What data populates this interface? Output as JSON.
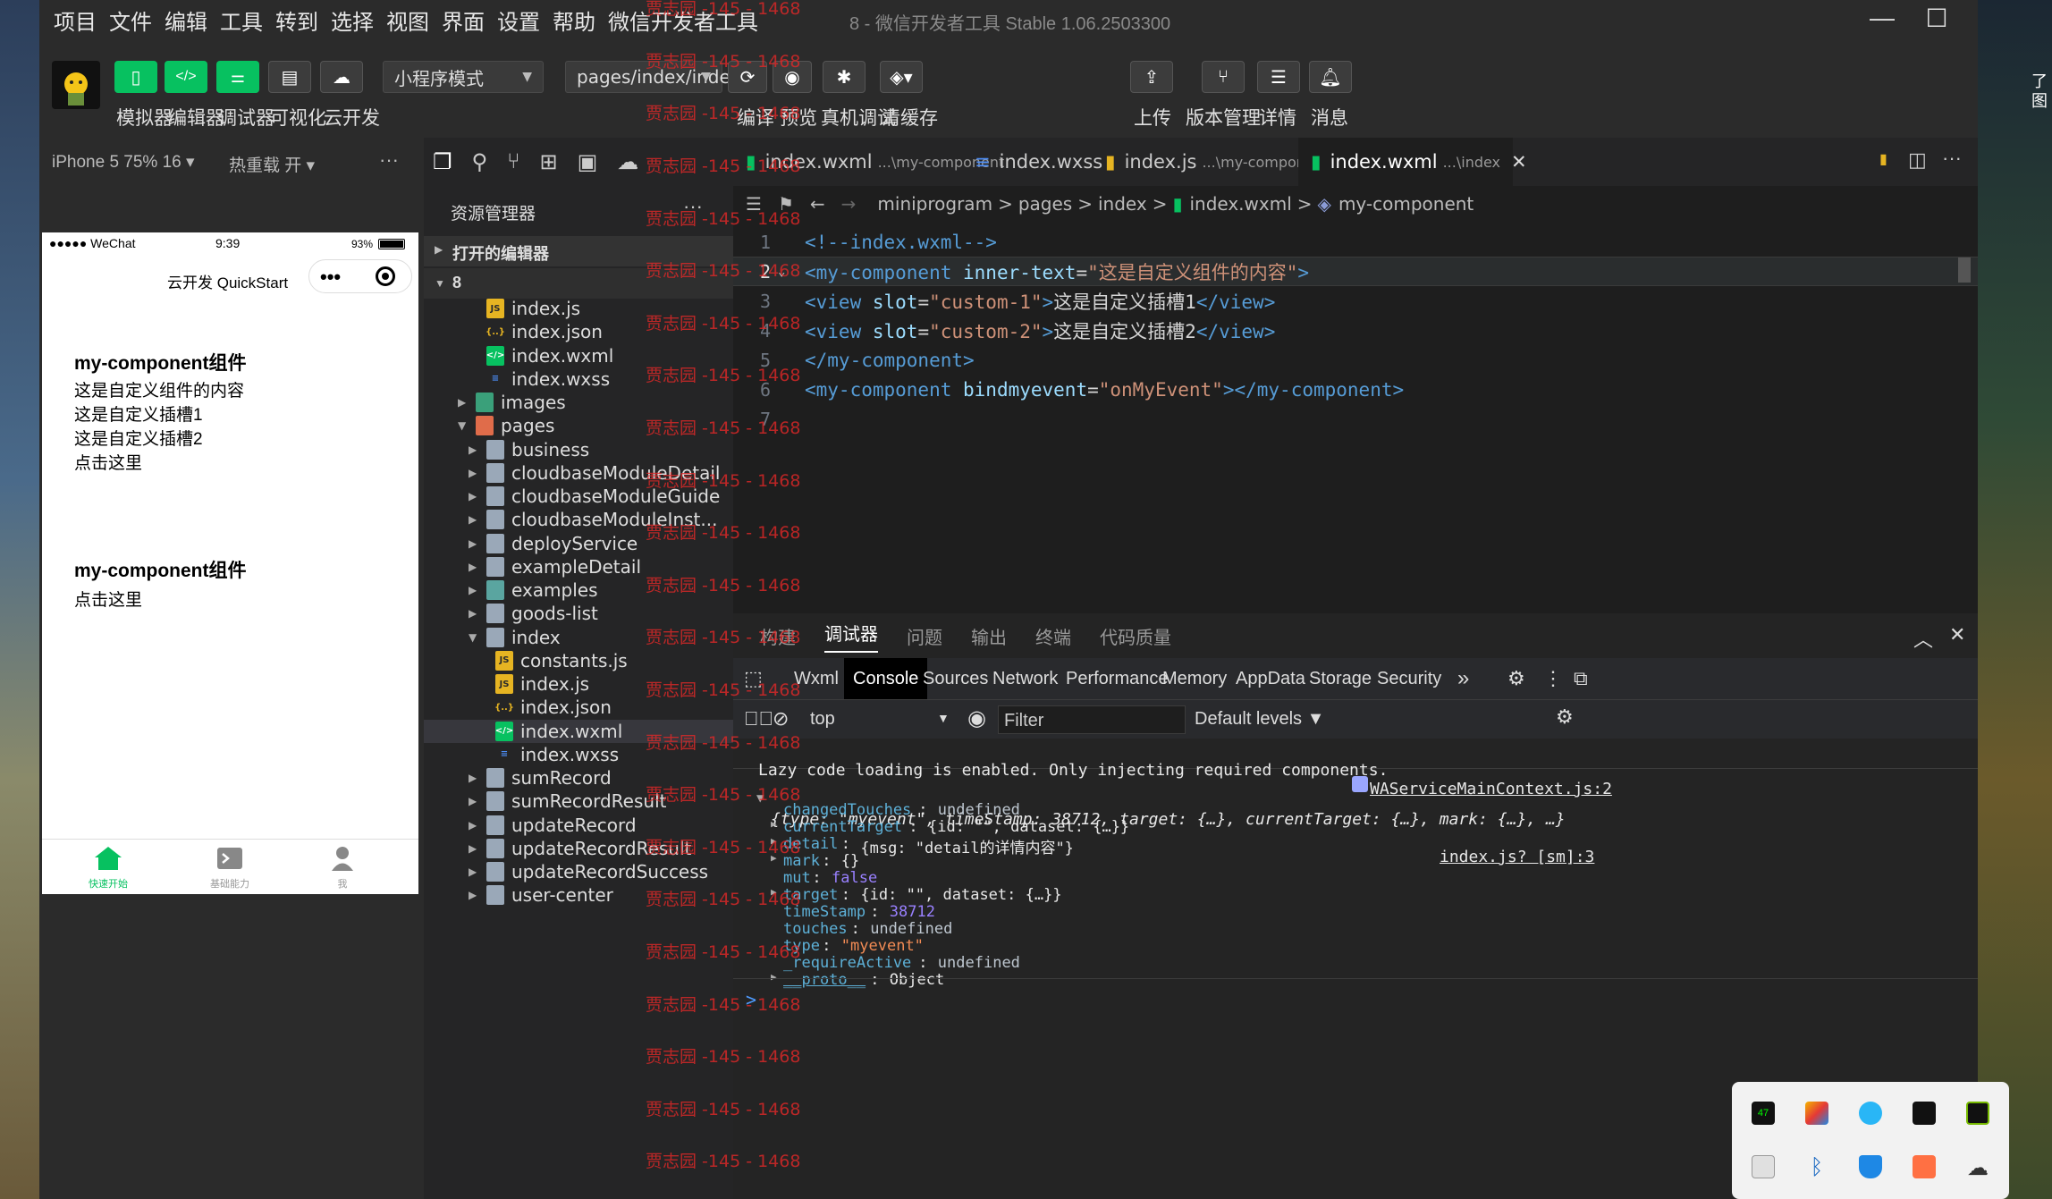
{
  "menubar": [
    "项目",
    "文件",
    "编辑",
    "工具",
    "转到",
    "选择",
    "视图",
    "界面",
    "设置",
    "帮助",
    "微信开发者工具"
  ],
  "window_title": "8 - 微信开发者工具 Stable 1.06.2503300",
  "desktop_side_text": "了\n图",
  "toolbar": {
    "simulator": "模拟器",
    "editor": "编辑器",
    "debugger": "调试器",
    "visual": "可视化",
    "cloud": "云开发",
    "mode_select": "小程序模式",
    "page_select": "pages/index/index",
    "compile": "编译",
    "preview": "预览",
    "real_debug": "真机调试",
    "clear_cache": "清缓存",
    "upload": "上传",
    "version": "版本管理",
    "details": "详情",
    "messages": "消息"
  },
  "sim": {
    "device": "iPhone 5 75% 16",
    "hot_reload": "热重载 开",
    "more": "···",
    "status_carrier": "●●●●● WeChat",
    "status_time": "9:39",
    "status_battery": "93%",
    "nav_title": "云开发 QuickStart",
    "capsule_dots": "•••",
    "block1_title": "my-component组件",
    "block1_lines": [
      "这是自定义组件的内容",
      "这是自定义插槽1",
      "这是自定义插槽2",
      "点击这里"
    ],
    "block2_title": "my-component组件",
    "block2_lines": [
      "点击这里"
    ],
    "tabbar": [
      "快速开始",
      "基础能力",
      "我"
    ],
    "colors": {
      "active": "#07c160",
      "inactive": "#999999"
    }
  },
  "explorer": {
    "title": "资源管理器",
    "more": "···",
    "open_editors": "打开的编辑器",
    "project": "8",
    "rows": [
      {
        "name": "index.js",
        "type": "js",
        "indent": 1
      },
      {
        "name": "index.json",
        "type": "json",
        "indent": 1
      },
      {
        "name": "index.wxml",
        "type": "wxml",
        "indent": 1
      },
      {
        "name": "index.wxss",
        "type": "wxss",
        "indent": 1
      },
      {
        "name": "images",
        "type": "folder-img",
        "indent": 0,
        "arrow": "right"
      },
      {
        "name": "pages",
        "type": "folder-pages",
        "indent": 0,
        "arrow": "down"
      },
      {
        "name": "business",
        "type": "folder",
        "indent": 1,
        "arrow": "right"
      },
      {
        "name": "cloudbaseModuleDetail",
        "type": "folder",
        "indent": 1,
        "arrow": "right"
      },
      {
        "name": "cloudbaseModuleGuide",
        "type": "folder",
        "indent": 1,
        "arrow": "right"
      },
      {
        "name": "cloudbaseModuleInst...",
        "type": "folder",
        "indent": 1,
        "arrow": "right"
      },
      {
        "name": "deployService",
        "type": "folder",
        "indent": 1,
        "arrow": "right"
      },
      {
        "name": "exampleDetail",
        "type": "folder",
        "indent": 1,
        "arrow": "right"
      },
      {
        "name": "examples",
        "type": "folder-green",
        "indent": 1,
        "arrow": "right"
      },
      {
        "name": "goods-list",
        "type": "folder",
        "indent": 1,
        "arrow": "right"
      },
      {
        "name": "index",
        "type": "folder",
        "indent": 1,
        "arrow": "down"
      },
      {
        "name": "constants.js",
        "type": "js",
        "indent": 2
      },
      {
        "name": "index.js",
        "type": "js",
        "indent": 2
      },
      {
        "name": "index.json",
        "type": "json",
        "indent": 2
      },
      {
        "name": "index.wxml",
        "type": "wxml",
        "indent": 2,
        "selected": true
      },
      {
        "name": "index.wxss",
        "type": "wxss",
        "indent": 2
      },
      {
        "name": "sumRecord",
        "type": "folder",
        "indent": 1,
        "arrow": "right"
      },
      {
        "name": "sumRecordResult",
        "type": "folder",
        "indent": 1,
        "arrow": "right"
      },
      {
        "name": "updateRecord",
        "type": "folder",
        "indent": 1,
        "arrow": "right"
      },
      {
        "name": "updateRecordResult",
        "type": "folder",
        "indent": 1,
        "arrow": "right"
      },
      {
        "name": "updateRecordSuccess",
        "type": "folder",
        "indent": 1,
        "arrow": "right"
      },
      {
        "name": "user-center",
        "type": "folder",
        "indent": 1,
        "arrow": "right"
      }
    ]
  },
  "editor": {
    "tabs": [
      {
        "name": "index.wxml",
        "sub": "...\\my-component",
        "type": "wxml"
      },
      {
        "name": "index.wxss",
        "sub": "",
        "type": "wxss"
      },
      {
        "name": "index.js",
        "sub": "...\\my-component",
        "type": "js"
      },
      {
        "name": "index.wxml",
        "sub": "...\\index",
        "type": "wxml",
        "active": true
      }
    ],
    "tab_more": "···",
    "breadcrumb": [
      "miniprogram",
      "pages",
      "index",
      "index.wxml",
      "my-component"
    ],
    "line_numbers": [
      "1",
      "2",
      "3",
      "4",
      "5",
      "6",
      "7"
    ],
    "lines": [
      "<!--index.wxml-->",
      "<my-component inner-text=\"这是自定义组件的内容\">",
      "<view slot=\"custom-1\">这是自定义插槽1</view>",
      "<view slot=\"custom-2\">这是自定义插槽2</view>",
      "</my-component>",
      "<my-component bindmyevent=\"onMyEvent\"></my-component>",
      ""
    ]
  },
  "debug": {
    "tabs": [
      "构建",
      "调试器",
      "问题",
      "输出",
      "终端",
      "代码质量"
    ],
    "devtools_tabs": [
      "Wxml",
      "Console",
      "Sources",
      "Network",
      "Performance",
      "Memory",
      "AppData",
      "Storage",
      "Security"
    ],
    "more_tabs": "»",
    "context": "top",
    "filter_placeholder": "Filter",
    "levels": "Default levels",
    "console": {
      "lazy_msg": "Lazy code loading is enabled. Only injecting required components.",
      "lazy_src": "WAServiceMainContext.js:2",
      "event_src": "index.js? [sm]:3",
      "event_summary": "{type: \"myevent\", timeStamp: 38712, target: {…}, currentTarget: {…}, mark: {…}, …}",
      "props": [
        {
          "key": "changedTouches",
          "value": "undefined",
          "kind": "undef",
          "expand": false
        },
        {
          "key": "currentTarget",
          "value": "{id: \"\", dataset: {…}}",
          "kind": "obj",
          "expand": true
        },
        {
          "key": "detail",
          "value": "{msg: \"detail的详情内容\"}",
          "kind": "obj",
          "expand": true
        },
        {
          "key": "mark",
          "value": "{}",
          "kind": "obj",
          "expand": true
        },
        {
          "key": "mut",
          "value": "false",
          "kind": "num",
          "expand": false
        },
        {
          "key": "target",
          "value": "{id: \"\", dataset: {…}}",
          "kind": "obj",
          "expand": true
        },
        {
          "key": "timeStamp",
          "value": "38712",
          "kind": "num",
          "expand": false
        },
        {
          "key": "touches",
          "value": "undefined",
          "kind": "undef",
          "expand": false
        },
        {
          "key": "type",
          "value": "\"myevent\"",
          "kind": "str",
          "expand": false
        },
        {
          "key": "_requireActive",
          "value": "undefined",
          "kind": "undef",
          "expand": false
        },
        {
          "key": "__proto__",
          "value": "Object",
          "kind": "proto",
          "expand": true
        }
      ],
      "prompt": ">"
    }
  },
  "watermark": "贾志园 -145 - 1468"
}
